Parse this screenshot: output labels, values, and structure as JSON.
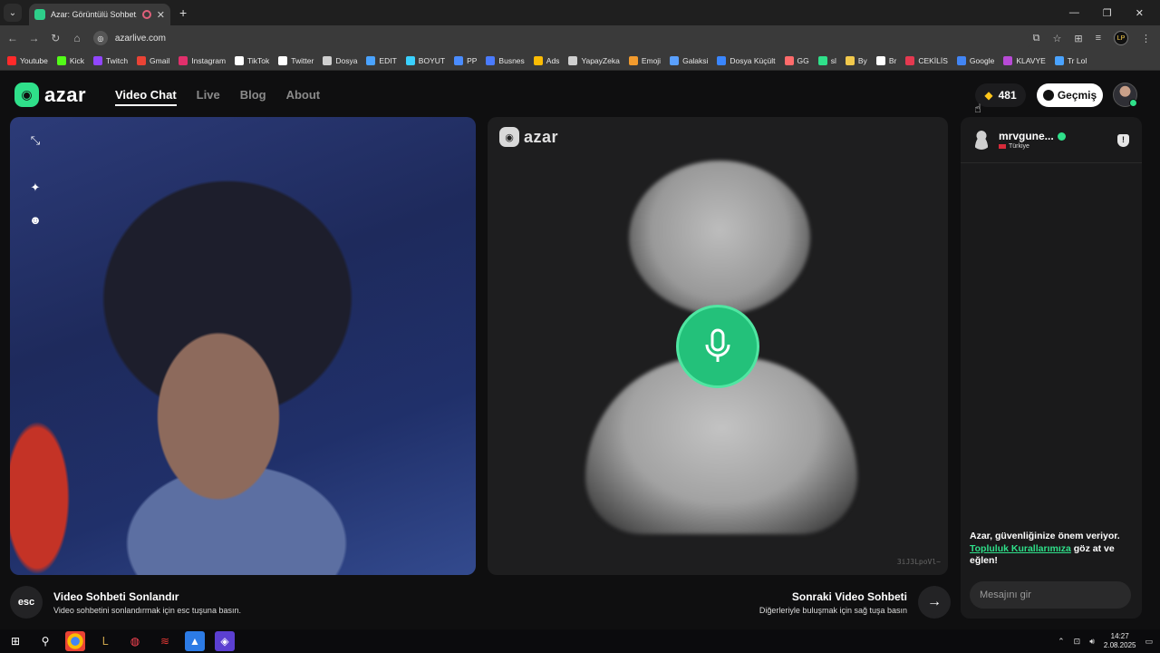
{
  "browser": {
    "tab_title": "Azar: Görüntülü Sohbet, Ar",
    "url": "azarlive.com",
    "bookmarks": [
      {
        "label": "Youtube",
        "color": "#ff2a2a"
      },
      {
        "label": "Kick",
        "color": "#53fc18"
      },
      {
        "label": "Twitch",
        "color": "#9146ff"
      },
      {
        "label": "Gmail",
        "color": "#ea4335"
      },
      {
        "label": "Instagram",
        "color": "#e1306c"
      },
      {
        "label": "TikTok",
        "color": "#ffffff"
      },
      {
        "label": "Twitter",
        "color": "#ffffff"
      },
      {
        "label": "Dosya",
        "color": "#cfcfcf"
      },
      {
        "label": "EDIT",
        "color": "#4aa3ff"
      },
      {
        "label": "BOYUT",
        "color": "#3ad1ff"
      },
      {
        "label": "PP",
        "color": "#4a8cff"
      },
      {
        "label": "Busnes",
        "color": "#4a7bff"
      },
      {
        "label": "Ads",
        "color": "#fbbc04"
      },
      {
        "label": "YapayZeka",
        "color": "#cfcfcf"
      },
      {
        "label": "Emoji",
        "color": "#f29b2e"
      },
      {
        "label": "Galaksi",
        "color": "#5aa0ff"
      },
      {
        "label": "Dosya Küçült",
        "color": "#3a86ff"
      },
      {
        "label": "GG",
        "color": "#ff6b6b"
      },
      {
        "label": "sl",
        "color": "#2fe08a"
      },
      {
        "label": "By",
        "color": "#f2c94c"
      },
      {
        "label": "Br",
        "color": "#ffffff"
      },
      {
        "label": "CEKİLİS",
        "color": "#e53950"
      },
      {
        "label": "Google",
        "color": "#4285f4"
      },
      {
        "label": "KLAVYE",
        "color": "#b84ad6"
      },
      {
        "label": "Tr Lol",
        "color": "#4aa3ff"
      }
    ]
  },
  "header": {
    "logo_text": "azar",
    "nav": [
      "Video Chat",
      "Live",
      "Blog",
      "About"
    ],
    "gems": "481",
    "history_label": "Geçmiş"
  },
  "remote": {
    "logo_text": "azar",
    "id_text": "3iJ3LpoVl~"
  },
  "bottom": {
    "esc_key": "esc",
    "end_title": "Video Sohbeti Sonlandır",
    "end_sub": "Video sohbetini sonlandırmak için esc tuşuna basın.",
    "next_title": "Sonraki Video Sohbeti",
    "next_sub": "Diğerleriyle buluşmak için sağ tuşa basın"
  },
  "chat": {
    "peer_name": "mrvgune...",
    "peer_country": "Türkiye",
    "safety_text_1": "Azar, güvenliğinize önem veriyor.",
    "safety_link": "Topluluk Kurallarımıza",
    "safety_text_2": " göz at ve eğlen!",
    "input_placeholder": "Mesajını gir"
  },
  "taskbar": {
    "time": "14:27",
    "date": "2.08.2025"
  },
  "colors": {
    "accent": "#2fe08a",
    "mic": "#23c17a",
    "gem": "#ffc61a"
  }
}
